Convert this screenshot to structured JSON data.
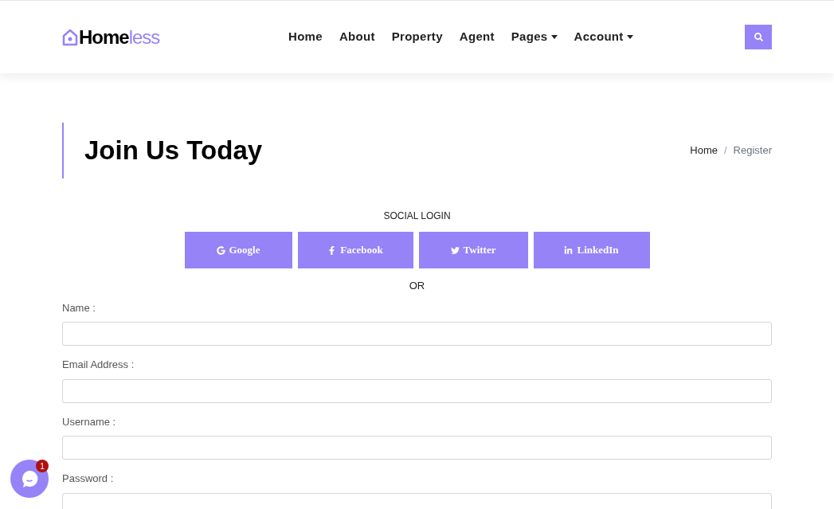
{
  "logo": {
    "dark": "Home",
    "light": "less"
  },
  "nav": [
    {
      "label": "Home",
      "dropdown": false
    },
    {
      "label": "About",
      "dropdown": false
    },
    {
      "label": "Property",
      "dropdown": false
    },
    {
      "label": "Agent",
      "dropdown": false
    },
    {
      "label": "Pages",
      "dropdown": true
    },
    {
      "label": "Account",
      "dropdown": true
    }
  ],
  "page_title": "Join Us Today",
  "breadcrumb": [
    {
      "label": "Home",
      "selected": false
    },
    {
      "label": "Register",
      "selected": true
    }
  ],
  "breadcrumb_separator": "/",
  "social_heading": "SOCIAL LOGIN",
  "social_buttons": [
    {
      "kind": "google",
      "label": "Google"
    },
    {
      "kind": "facebook",
      "label": "Facebook"
    },
    {
      "kind": "twitter",
      "label": "Twitter"
    },
    {
      "kind": "linkedin",
      "label": "LinkedIn"
    }
  ],
  "divider_text": "OR",
  "fields": [
    {
      "label": "Name :"
    },
    {
      "label": "Email Address :"
    },
    {
      "label": "Username :"
    },
    {
      "label": "Password :"
    }
  ],
  "chat_badge": "1"
}
